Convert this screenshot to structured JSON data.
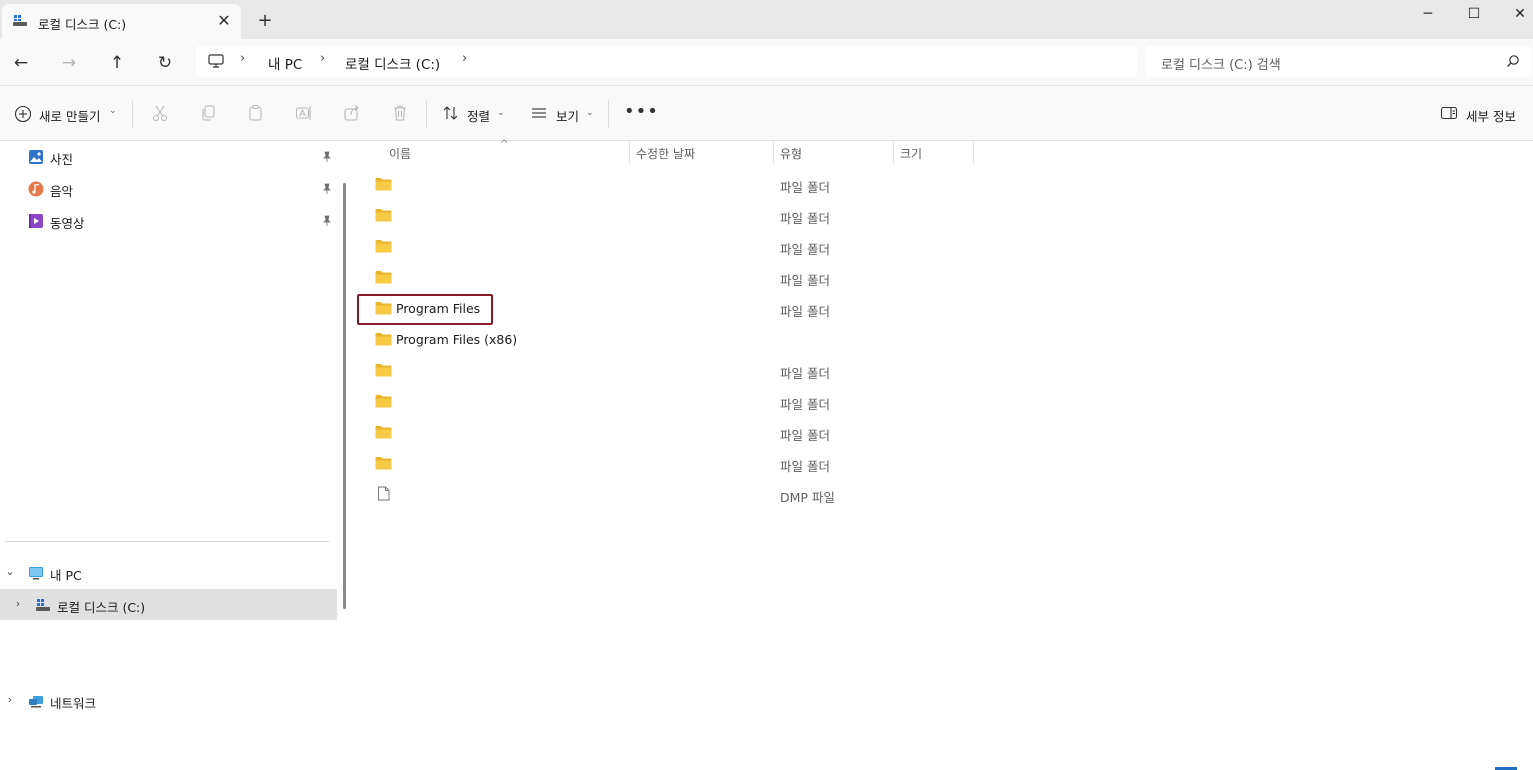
{
  "window": {
    "tab_title": "로컬 디스크 (C:)",
    "close_tab_glyph": "✕",
    "new_tab_glyph": "+",
    "minimize_glyph": "─",
    "maximize_glyph": "☐",
    "close_glyph": "✕"
  },
  "address": {
    "back_glyph": "←",
    "forward_glyph": "→",
    "up_glyph": "↑",
    "refresh_glyph": "↻",
    "breadcrumbs": [
      "내 PC",
      "로컬 디스크 (C:)"
    ],
    "separator": "›",
    "search_placeholder": "로컬 디스크 (C:) 검색"
  },
  "commandbar": {
    "new_label": "새로 만들기",
    "sort_label": "정렬",
    "view_label": "보기",
    "more_glyph": "•••",
    "details_label": "세부 정보",
    "caret": "⌄"
  },
  "navigation": {
    "quick_access": [
      {
        "label": "사진",
        "icon": "pictures-icon"
      },
      {
        "label": "음악",
        "icon": "music-icon"
      },
      {
        "label": "동영상",
        "icon": "videos-icon"
      }
    ],
    "this_pc": "내 PC",
    "local_disk": "로컬 디스크 (C:)",
    "network": "네트워크",
    "expanded_glyph": "⌄",
    "collapsed_glyph": "›"
  },
  "columns": {
    "name": "이름",
    "modified": "수정한 날짜",
    "type": "유형",
    "size": "크기",
    "sort_indicator": "^"
  },
  "files": [
    {
      "name": "",
      "type": "파일 폴더",
      "kind": "folder"
    },
    {
      "name": "",
      "type": "파일 폴더",
      "kind": "folder"
    },
    {
      "name": "",
      "type": "파일 폴더",
      "kind": "folder"
    },
    {
      "name": "",
      "type": "파일 폴더",
      "kind": "folder"
    },
    {
      "name": "Program Files",
      "type": "파일 폴더",
      "kind": "folder"
    },
    {
      "name": "Program Files (x86)",
      "type": "",
      "kind": "folder"
    },
    {
      "name": "",
      "type": "파일 폴더",
      "kind": "folder"
    },
    {
      "name": "",
      "type": "파일 폴더",
      "kind": "folder"
    },
    {
      "name": "",
      "type": "파일 폴더",
      "kind": "folder"
    },
    {
      "name": "",
      "type": "파일 폴더",
      "kind": "folder"
    },
    {
      "name": "",
      "type": "DMP 파일",
      "kind": "file"
    }
  ],
  "colors": {
    "folder_yellow": "#f8c945",
    "highlight_border": "#8b1a2a",
    "selected_nav_bg": "#e0e0e0",
    "chrome_bg": "#f9f9f9"
  }
}
